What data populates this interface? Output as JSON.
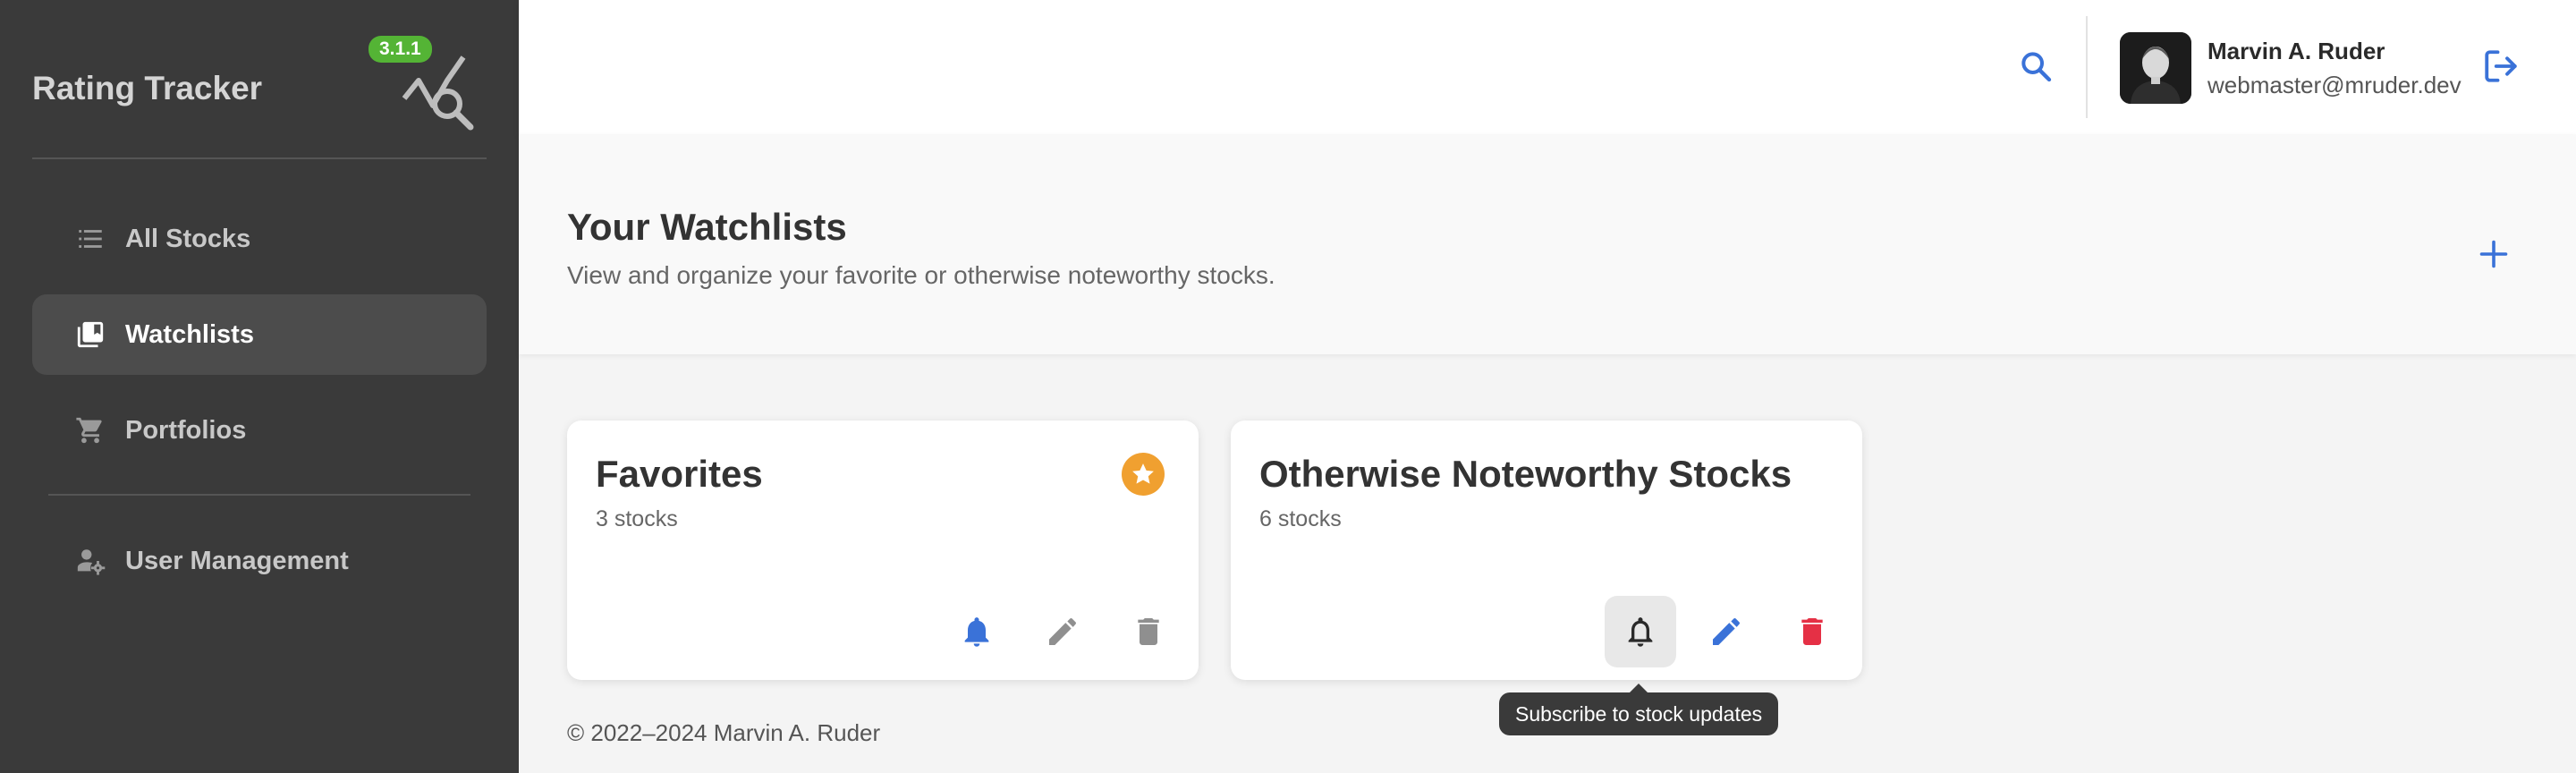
{
  "app": {
    "title": "Rating Tracker",
    "version": "3.1.1"
  },
  "sidebar": {
    "items": [
      {
        "label": "All Stocks",
        "icon": "list-icon"
      },
      {
        "label": "Watchlists",
        "icon": "bookmarks-icon",
        "active": true
      },
      {
        "label": "Portfolios",
        "icon": "cart-icon"
      },
      {
        "label": "User Management",
        "icon": "user-settings-icon"
      }
    ]
  },
  "header": {
    "user": {
      "name": "Marvin A. Ruder",
      "email": "webmaster@mruder.dev"
    }
  },
  "page": {
    "title": "Your Watchlists",
    "subtitle": "View and organize your favorite or otherwise noteworthy stocks."
  },
  "watchlists": [
    {
      "title": "Favorites",
      "count": "3 stocks",
      "favorite": true,
      "subscribed": true
    },
    {
      "title": "Otherwise Noteworthy Stocks",
      "count": "6 stocks",
      "favorite": false,
      "subscribed": false
    }
  ],
  "tooltip": "Subscribe to stock updates",
  "footer": "© 2022–2024 Marvin A. Ruder",
  "colors": {
    "accent": "#3a72d8",
    "danger": "#e53045",
    "favorite": "#f0a030",
    "version_badge": "#54b435",
    "sidebar_bg": "#3a3a3a"
  }
}
